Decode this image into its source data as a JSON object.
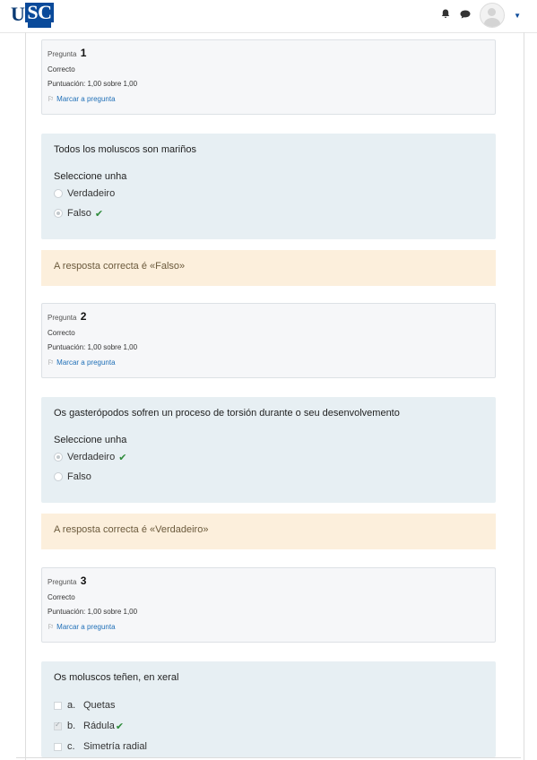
{
  "header": {
    "logo_u": "U",
    "logo_sc": "SC",
    "icons": [
      "bell-icon",
      "chat-icon",
      "user-avatar",
      "chevron-down-icon"
    ]
  },
  "questions": [
    {
      "number_label": "Pregunta",
      "number": "1",
      "status": "Correcto",
      "score": "Puntuación: 1,00 sobre 1,00",
      "flag": "Marcar a pregunta",
      "text": "Todos los moluscos son mariños",
      "select_label": "Seleccione unha",
      "options": [
        {
          "label": "Verdadeiro",
          "selected": false,
          "correct": false
        },
        {
          "label": "Falso",
          "selected": true,
          "correct": true
        }
      ],
      "feedback": "A resposta correcta é «Falso»"
    },
    {
      "number_label": "Pregunta",
      "number": "2",
      "status": "Correcto",
      "score": "Puntuación: 1,00 sobre 1,00",
      "flag": "Marcar a pregunta",
      "text": "Os gasterópodos sofren un proceso de torsión durante o seu desenvolvemento",
      "select_label": "Seleccione unha",
      "options": [
        {
          "label": "Verdadeiro",
          "selected": true,
          "correct": true
        },
        {
          "label": "Falso",
          "selected": false,
          "correct": false
        }
      ],
      "feedback": "A resposta correcta é «Verdadeiro»"
    },
    {
      "number_label": "Pregunta",
      "number": "3",
      "status": "Correcto",
      "score": "Puntuación: 1,00 sobre 1,00",
      "flag": "Marcar a pregunta",
      "text": "Os moluscos teñen, en xeral",
      "options": [
        {
          "letter": "a.",
          "label": "Quetas",
          "selected": false,
          "correct": false
        },
        {
          "letter": "b.",
          "label": "Rádula",
          "selected": true,
          "correct": true
        },
        {
          "letter": "c.",
          "label": "Simetría radial",
          "selected": false,
          "correct": false
        }
      ]
    }
  ],
  "colors": {
    "info_bg": "#f6f7f9",
    "question_bg": "#e7eff3",
    "feedback_bg": "#fcefdc",
    "correct_check": "#2e8b3a",
    "link": "#1f6fb7",
    "brand": "#0a4a9a"
  }
}
